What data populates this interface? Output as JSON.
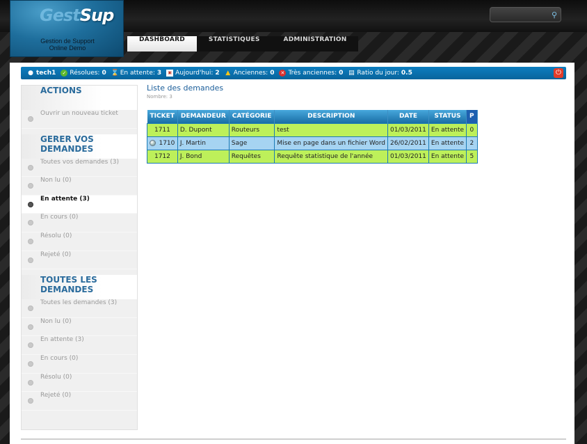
{
  "header": {
    "logo": {
      "word_a": "Gest",
      "word_b": "Sup",
      "subtitle_1": "Gestion de Support",
      "subtitle_2": "Online Demo"
    },
    "search": {
      "value": "",
      "icon": "search-icon"
    },
    "nav": [
      {
        "label": "DASHBOARD",
        "active": true
      },
      {
        "label": "STATISTIQUES",
        "active": false
      },
      {
        "label": "ADMINISTRATION",
        "active": false
      }
    ]
  },
  "statusbar": {
    "user": "tech1",
    "resolues": {
      "label": "Résolues:",
      "value": "0"
    },
    "en_attente": {
      "label": "En attente:",
      "value": "3"
    },
    "aujourdhui": {
      "label": "Aujourd'hui:",
      "value": "2"
    },
    "anciennes": {
      "label": "Anciennes:",
      "value": "0"
    },
    "tres_anciennes": {
      "label": "Très anciennes:",
      "value": "0"
    },
    "ratio": {
      "label": "Ratio du jour:",
      "value": "0.5"
    }
  },
  "sidebar": {
    "actions_title": "ACTIONS",
    "actions": [
      "Ouvrir un nouveau ticket"
    ],
    "mine_title": "GERER VOS DEMANDES",
    "mine": [
      "Toutes vos demandes (3)",
      "Non lu (0)",
      "En attente (3)",
      "En cours (0)",
      "Résolu (0)",
      "Rejeté (0)"
    ],
    "all_title": "TOUTES LES DEMANDES",
    "all": [
      "Toutes les demandes (3)",
      "Non lu (0)",
      "En attente (3)",
      "En cours (0)",
      "Résolu (0)",
      "Rejeté (0)"
    ]
  },
  "main": {
    "title": "Liste des demandes",
    "count": "Nombre: 3",
    "columns": [
      "TICKET",
      "DEMANDEUR",
      "CATÉGORIE",
      "DESCRIPTION",
      "DATE",
      "STATUS",
      "P"
    ],
    "rows": [
      [
        "1711",
        "D. Dupont",
        "Routeurs",
        "test",
        "01/03/2011",
        "En attente",
        "0"
      ],
      [
        "1710",
        "J. Martin",
        "Sage",
        "Mise en page dans un fichier Word",
        "26/02/2011",
        "En attente",
        "2"
      ],
      [
        "1712",
        "J. Bond",
        "Requêtes",
        "Requête statistique de l'année",
        "01/03/2011",
        "En attente",
        "5"
      ]
    ]
  },
  "colors": {
    "accent": "#1b7ab5",
    "row_green": "#bdf05a",
    "row_blue": "#a6d4f2"
  }
}
